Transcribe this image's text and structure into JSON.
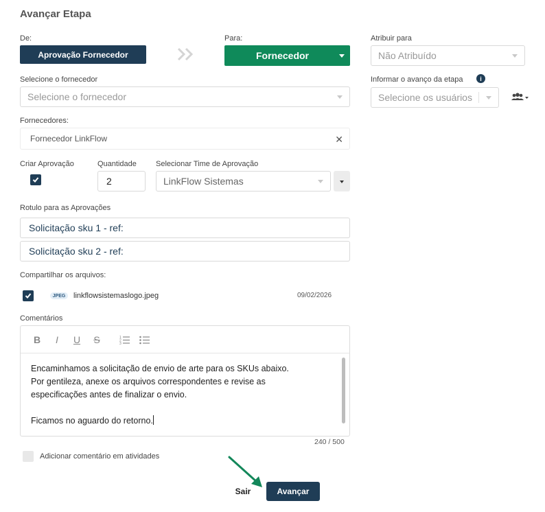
{
  "dialog": {
    "title": "Avançar Etapa"
  },
  "from": {
    "label": "De:",
    "stage": "Aprovação Fornecedor"
  },
  "to": {
    "label": "Para:",
    "stage": "Fornecedor"
  },
  "assign": {
    "label": "Atribuir para",
    "value": "Não Atribuído"
  },
  "supplier_select": {
    "label": "Selecione o fornecedor",
    "placeholder": "Selecione o fornecedor"
  },
  "notify": {
    "label": "Informar o avanço da etapa",
    "placeholder": "Selecione os usuários"
  },
  "suppliers": {
    "label": "Fornecedores:",
    "selected": "Fornecedor LinkFlow"
  },
  "approval": {
    "create_label": "Criar Aprovação",
    "quantity_label": "Quantidade",
    "quantity_value": "2",
    "team_label": "Selecionar Time de Aprovação",
    "team_value": "LinkFlow Sistemas"
  },
  "labels_section": {
    "label": "Rotulo para as Aprovações",
    "items": [
      "Solicitação sku 1 - ref:",
      "Solicitação sku 2 - ref:"
    ]
  },
  "files": {
    "label": "Compartilhar os arquivos:",
    "items": [
      {
        "badge": "JPEG",
        "name": "linkflowsistemaslogo.jpeg",
        "date": "09/02/2026"
      }
    ]
  },
  "comments": {
    "label": "Comentários",
    "toolbar": [
      "B",
      "I",
      "U",
      "S"
    ],
    "lines": [
      "Encaminhamos a solicitação de envio de arte para os SKUs abaixo.",
      "Por gentileza, anexe os arquivos correspondentes e revise as",
      "especificações antes de finalizar o envio.",
      "",
      "Ficamos no aguardo do retorno."
    ],
    "counter": "240 / 500",
    "add_activity_label": "Adicionar comentário em atividades"
  },
  "actions": {
    "exit": "Sair",
    "advance": "Avançar"
  },
  "colors": {
    "primary_dark": "#1f3d56",
    "primary_green": "#0f8a5a",
    "annotation_arrow": "#13875a"
  }
}
